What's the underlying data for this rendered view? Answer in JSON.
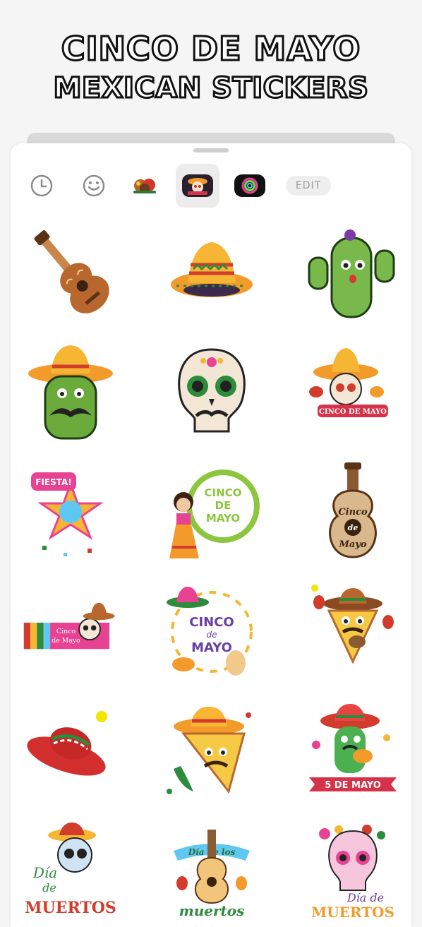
{
  "headline": {
    "line1": "CINCO DE MAYO",
    "line2": "MEXICAN STICKERS"
  },
  "toolbar": {
    "tabs": [
      {
        "icon": "clock-icon"
      },
      {
        "icon": "smiley-icon"
      },
      {
        "icon": "pack-thumbnail-icon"
      },
      {
        "icon": "cinco-de-mayo-pack-icon"
      },
      {
        "icon": "ring-pack-icon"
      }
    ],
    "edit_label": "EDIT"
  },
  "stickers": {
    "banner_cinco": "CINCO DE MAYO",
    "fiesta": "FIESTA!",
    "badge_l1": "CINCO",
    "badge_l2": "DE",
    "badge_l3": "MAYO",
    "guitar_l1": "Cinco",
    "guitar_l2": "de",
    "guitar_l3": "Mayo",
    "serape_l1": "Cinco",
    "serape_l2": "de Mayo",
    "wreath_l1": "CINCO",
    "wreath_l2": "de",
    "wreath_l3": "MAYO",
    "ribbon_5": "5 DE MAYO",
    "dia1_l1": "Día",
    "dia1_l2": "de",
    "dia1_l3": "MUERTOS",
    "dia2_l1": "Día de los",
    "dia2_l2": "muertos",
    "dia3_l1": "Día de",
    "dia3_l2": "MUERTOS"
  }
}
